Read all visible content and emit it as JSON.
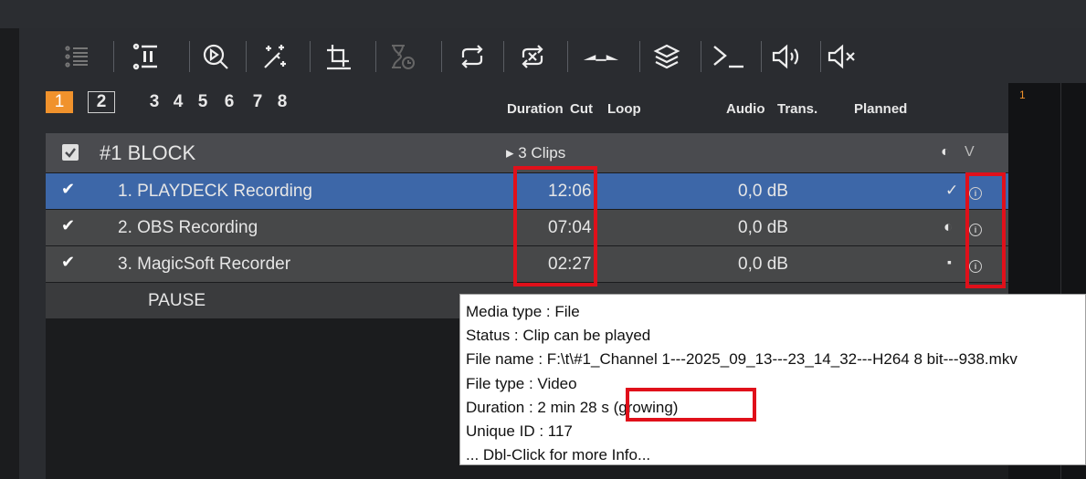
{
  "toolbar": {
    "buttons": [
      {
        "name": "playlist-icon"
      },
      {
        "name": "pause-block-icon"
      },
      {
        "name": "zoom-play-icon"
      },
      {
        "name": "magic-wand-icon"
      },
      {
        "name": "crop-icon"
      },
      {
        "name": "timer-icon"
      },
      {
        "name": "loop-icon"
      },
      {
        "name": "shuffle-icon"
      },
      {
        "name": "fade-icon"
      },
      {
        "name": "layers-icon"
      },
      {
        "name": "terminal-icon"
      },
      {
        "name": "volume-icon"
      },
      {
        "name": "mute-icon"
      }
    ]
  },
  "tabs": [
    "1",
    "2",
    "3",
    "4",
    "5",
    "6",
    "7",
    "8"
  ],
  "columns": {
    "duration": "Duration",
    "cut": "Cut",
    "loop": "Loop",
    "audio": "Audio",
    "trans": "Trans.",
    "planned": "Planned"
  },
  "right_panel": {
    "number": "1"
  },
  "block": {
    "title": "#1  BLOCK",
    "clips": "▸ 3 Clips"
  },
  "clips": [
    {
      "name": "1. PLAYDECK Recording",
      "duration": "12:06",
      "audio": "0,0 dB",
      "status": "✓"
    },
    {
      "name": "2. OBS Recording",
      "duration": "07:04",
      "audio": "0,0 dB",
      "status": "◐"
    },
    {
      "name": "3. MagicSoft Recorder",
      "duration": "02:27",
      "audio": "0,0 dB",
      "status": "▪"
    }
  ],
  "pause": "PAUSE",
  "tooltip": {
    "lines": [
      "Media type : File",
      "Status : Clip can be played",
      "File name : F:\\t\\#1_Channel 1---2025_09_13---23_14_32---H264  8 bit---938.mkv",
      "File type : Video",
      "Duration : 2 min 28 s (growing)",
      "Unique ID : 117",
      "... Dbl-Click for more Info..."
    ]
  },
  "colors": {
    "accent": "#f0922c",
    "selected": "#3d67a8",
    "highlight": "#e0101a"
  }
}
